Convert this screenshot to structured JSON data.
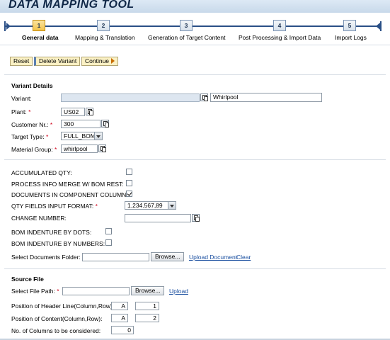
{
  "app": {
    "title": "DATA MAPPING TOOL"
  },
  "roadmap": {
    "steps": [
      {
        "num": "1",
        "label": "General data",
        "active": true
      },
      {
        "num": "2",
        "label": "Mapping & Translation"
      },
      {
        "num": "3",
        "label": "Generation of Target Content"
      },
      {
        "num": "4",
        "label": "Post Processing & Import Data"
      },
      {
        "num": "5",
        "label": "Import Logs"
      }
    ]
  },
  "toolbar": {
    "reset": "Reset",
    "delete_variant": "Delete Variant",
    "continue": "Continue"
  },
  "variant_details": {
    "title": "Variant Details",
    "variant_label": "Variant:",
    "variant_value": "",
    "variant_desc": "Whirlpool",
    "plant_label": "Plant:",
    "plant_value": "US02",
    "customer_label": "Customer Nr.:",
    "customer_value": "300",
    "target_type_label": "Target Type:",
    "target_type_value": "FULL_BOM",
    "material_group_label": "Material Group:",
    "material_group_value": "whirlpool",
    "required_mark": "*"
  },
  "options": {
    "accumulated_qty_label": "ACCUMULATED QTY:",
    "accumulated_qty_checked": false,
    "process_info_label": "PROCESS INFO MERGE W/ BOM REST:",
    "process_info_checked": false,
    "documents_label": "DOCUMENTS IN COMPONENT COLUMN:",
    "documents_checked": true,
    "qty_format_label": "QTY FIELDS INPUT FORMAT:",
    "qty_format_value": "1.234.567,89",
    "change_number_label": "CHANGE NUMBER:",
    "change_number_value": "",
    "indenture_dots_label": "BOM INDENTURE BY DOTS:",
    "indenture_dots_checked": false,
    "indenture_numbers_label": "BOM INDENTURE BY NUMBERS:",
    "indenture_numbers_checked": false,
    "docs_folder_label": "Select Documents Folder:",
    "docs_folder_value": "",
    "browse": "Browse...",
    "upload_document": "Upload Document",
    "clear": "Clear"
  },
  "source_file": {
    "title": "Source File",
    "file_path_label": "Select File Path:",
    "file_path_value": "",
    "browse": "Browse...",
    "upload": "Upload",
    "header_line_label": "Position of Header Line(Column,Row):",
    "header_col": "A",
    "header_row": "1",
    "content_label": "Position of Content(Column,Row):",
    "content_col": "A",
    "content_row": "2",
    "num_columns_label": "No. of Columns to be considered:",
    "num_columns_value": "0"
  },
  "colors": {
    "header_bg": "#c8d9ea",
    "title": "#0f2747",
    "active_step": "#f3c34b",
    "button": "#fbf1c4",
    "required": "#d0001a",
    "link": "#1a4fa0"
  }
}
